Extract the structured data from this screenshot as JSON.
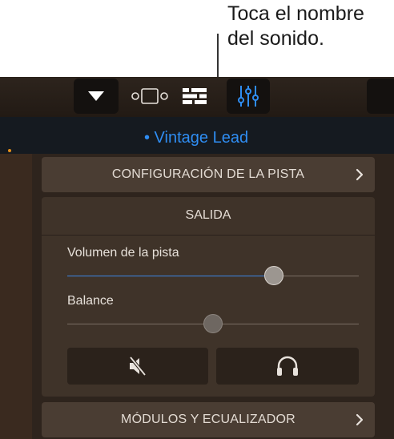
{
  "callout": {
    "line1": "Toca el nombre",
    "line2": "del sonido."
  },
  "toolbar": {
    "buttons": [
      {
        "name": "dropdown",
        "icon": "triangle-down-icon"
      },
      {
        "name": "view-toggle",
        "icon": "view-toggle-icon"
      },
      {
        "name": "tracks-view",
        "icon": "tracks-view-icon"
      },
      {
        "name": "mixer",
        "icon": "mixer-icon",
        "active": true
      }
    ]
  },
  "header": {
    "sound_name": "• Vintage Lead"
  },
  "sections": {
    "track_settings": "CONFIGURACIÓN DE LA PISTA",
    "output": "SALIDA",
    "plugins_eq": "MÓDULOS Y ECUALIZADOR"
  },
  "output": {
    "volume_label": "Volumen de la pista",
    "volume_value": 0.71,
    "balance_label": "Balance",
    "balance_value": 0.5
  },
  "colors": {
    "accent": "#2f8df2",
    "slider_fill": "#3b86e6",
    "panel": "#3f3329"
  },
  "buttons": {
    "mute_icon": "speaker-mute-icon",
    "solo_icon": "headphones-icon"
  }
}
